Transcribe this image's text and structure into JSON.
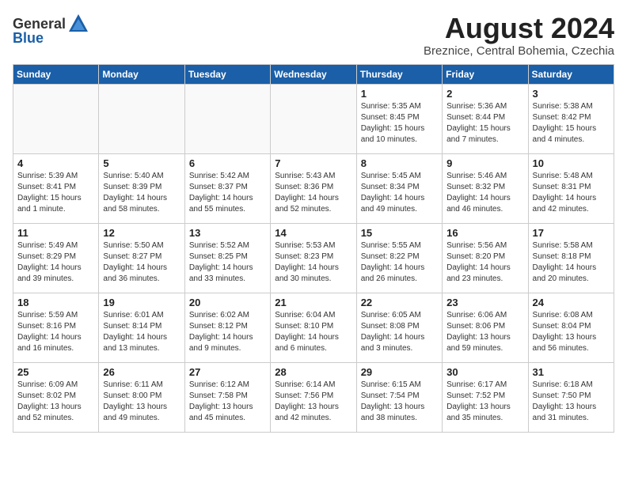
{
  "header": {
    "logo_general": "General",
    "logo_blue": "Blue",
    "month_year": "August 2024",
    "location": "Breznice, Central Bohemia, Czechia"
  },
  "days_of_week": [
    "Sunday",
    "Monday",
    "Tuesday",
    "Wednesday",
    "Thursday",
    "Friday",
    "Saturday"
  ],
  "weeks": [
    [
      {
        "day": "",
        "info": ""
      },
      {
        "day": "",
        "info": ""
      },
      {
        "day": "",
        "info": ""
      },
      {
        "day": "",
        "info": ""
      },
      {
        "day": "1",
        "info": "Sunrise: 5:35 AM\nSunset: 8:45 PM\nDaylight: 15 hours\nand 10 minutes."
      },
      {
        "day": "2",
        "info": "Sunrise: 5:36 AM\nSunset: 8:44 PM\nDaylight: 15 hours\nand 7 minutes."
      },
      {
        "day": "3",
        "info": "Sunrise: 5:38 AM\nSunset: 8:42 PM\nDaylight: 15 hours\nand 4 minutes."
      }
    ],
    [
      {
        "day": "4",
        "info": "Sunrise: 5:39 AM\nSunset: 8:41 PM\nDaylight: 15 hours\nand 1 minute."
      },
      {
        "day": "5",
        "info": "Sunrise: 5:40 AM\nSunset: 8:39 PM\nDaylight: 14 hours\nand 58 minutes."
      },
      {
        "day": "6",
        "info": "Sunrise: 5:42 AM\nSunset: 8:37 PM\nDaylight: 14 hours\nand 55 minutes."
      },
      {
        "day": "7",
        "info": "Sunrise: 5:43 AM\nSunset: 8:36 PM\nDaylight: 14 hours\nand 52 minutes."
      },
      {
        "day": "8",
        "info": "Sunrise: 5:45 AM\nSunset: 8:34 PM\nDaylight: 14 hours\nand 49 minutes."
      },
      {
        "day": "9",
        "info": "Sunrise: 5:46 AM\nSunset: 8:32 PM\nDaylight: 14 hours\nand 46 minutes."
      },
      {
        "day": "10",
        "info": "Sunrise: 5:48 AM\nSunset: 8:31 PM\nDaylight: 14 hours\nand 42 minutes."
      }
    ],
    [
      {
        "day": "11",
        "info": "Sunrise: 5:49 AM\nSunset: 8:29 PM\nDaylight: 14 hours\nand 39 minutes."
      },
      {
        "day": "12",
        "info": "Sunrise: 5:50 AM\nSunset: 8:27 PM\nDaylight: 14 hours\nand 36 minutes."
      },
      {
        "day": "13",
        "info": "Sunrise: 5:52 AM\nSunset: 8:25 PM\nDaylight: 14 hours\nand 33 minutes."
      },
      {
        "day": "14",
        "info": "Sunrise: 5:53 AM\nSunset: 8:23 PM\nDaylight: 14 hours\nand 30 minutes."
      },
      {
        "day": "15",
        "info": "Sunrise: 5:55 AM\nSunset: 8:22 PM\nDaylight: 14 hours\nand 26 minutes."
      },
      {
        "day": "16",
        "info": "Sunrise: 5:56 AM\nSunset: 8:20 PM\nDaylight: 14 hours\nand 23 minutes."
      },
      {
        "day": "17",
        "info": "Sunrise: 5:58 AM\nSunset: 8:18 PM\nDaylight: 14 hours\nand 20 minutes."
      }
    ],
    [
      {
        "day": "18",
        "info": "Sunrise: 5:59 AM\nSunset: 8:16 PM\nDaylight: 14 hours\nand 16 minutes."
      },
      {
        "day": "19",
        "info": "Sunrise: 6:01 AM\nSunset: 8:14 PM\nDaylight: 14 hours\nand 13 minutes."
      },
      {
        "day": "20",
        "info": "Sunrise: 6:02 AM\nSunset: 8:12 PM\nDaylight: 14 hours\nand 9 minutes."
      },
      {
        "day": "21",
        "info": "Sunrise: 6:04 AM\nSunset: 8:10 PM\nDaylight: 14 hours\nand 6 minutes."
      },
      {
        "day": "22",
        "info": "Sunrise: 6:05 AM\nSunset: 8:08 PM\nDaylight: 14 hours\nand 3 minutes."
      },
      {
        "day": "23",
        "info": "Sunrise: 6:06 AM\nSunset: 8:06 PM\nDaylight: 13 hours\nand 59 minutes."
      },
      {
        "day": "24",
        "info": "Sunrise: 6:08 AM\nSunset: 8:04 PM\nDaylight: 13 hours\nand 56 minutes."
      }
    ],
    [
      {
        "day": "25",
        "info": "Sunrise: 6:09 AM\nSunset: 8:02 PM\nDaylight: 13 hours\nand 52 minutes."
      },
      {
        "day": "26",
        "info": "Sunrise: 6:11 AM\nSunset: 8:00 PM\nDaylight: 13 hours\nand 49 minutes."
      },
      {
        "day": "27",
        "info": "Sunrise: 6:12 AM\nSunset: 7:58 PM\nDaylight: 13 hours\nand 45 minutes."
      },
      {
        "day": "28",
        "info": "Sunrise: 6:14 AM\nSunset: 7:56 PM\nDaylight: 13 hours\nand 42 minutes."
      },
      {
        "day": "29",
        "info": "Sunrise: 6:15 AM\nSunset: 7:54 PM\nDaylight: 13 hours\nand 38 minutes."
      },
      {
        "day": "30",
        "info": "Sunrise: 6:17 AM\nSunset: 7:52 PM\nDaylight: 13 hours\nand 35 minutes."
      },
      {
        "day": "31",
        "info": "Sunrise: 6:18 AM\nSunset: 7:50 PM\nDaylight: 13 hours\nand 31 minutes."
      }
    ]
  ]
}
